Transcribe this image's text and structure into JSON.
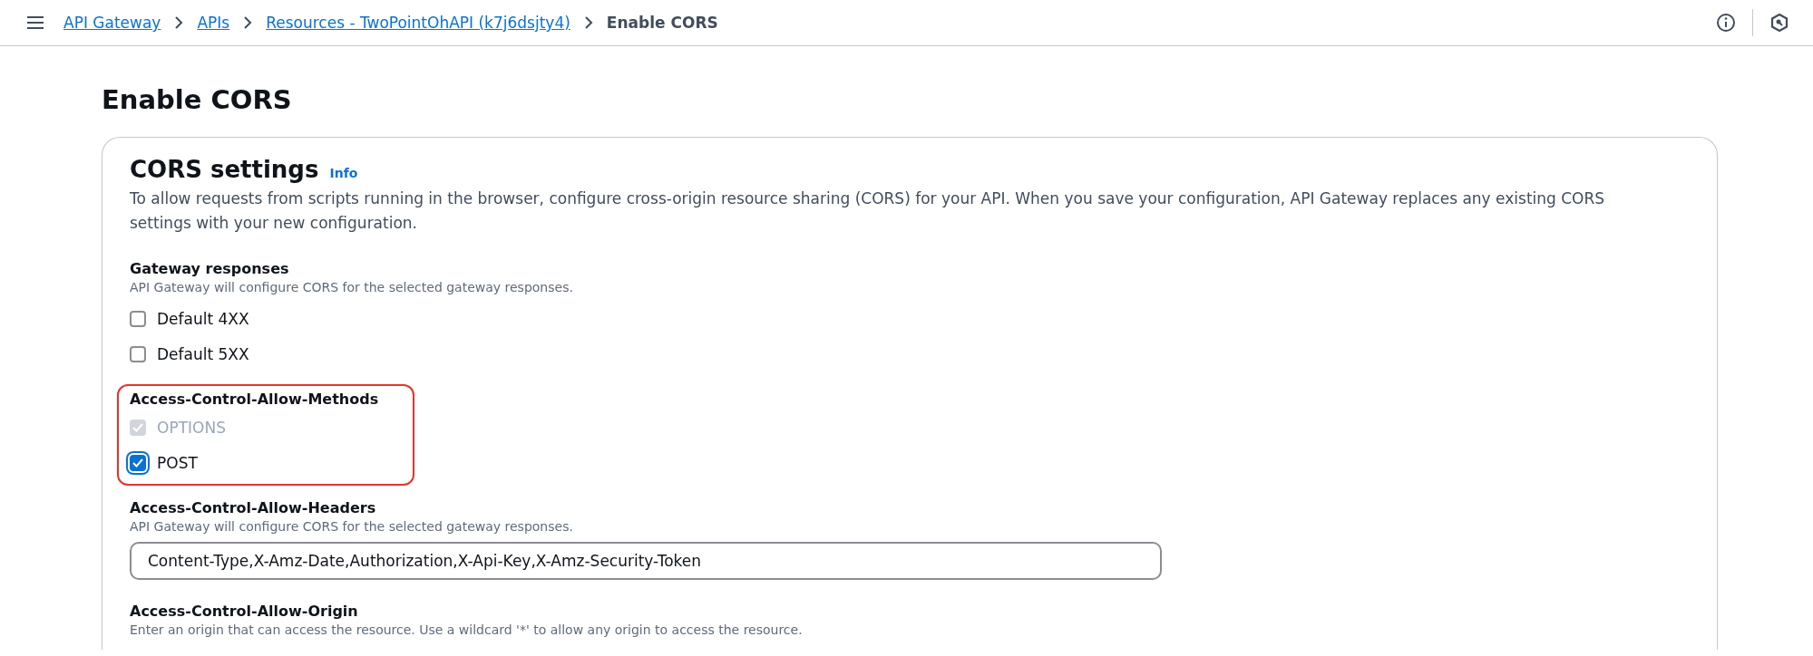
{
  "breadcrumbs": [
    {
      "label": "API Gateway",
      "kind": "link"
    },
    {
      "label": "APIs",
      "kind": "link"
    },
    {
      "label": "Resources - TwoPointOhAPI (k7j6dsjty4)",
      "kind": "link"
    },
    {
      "label": "Enable CORS",
      "kind": "current"
    }
  ],
  "page_title": "Enable CORS",
  "panel": {
    "title": "CORS settings",
    "info_link": "Info",
    "description": "To allow requests from scripts running in the browser, configure cross-origin resource sharing (CORS) for your API. When you save your configuration, API Gateway replaces any existing CORS settings with your new configuration.",
    "sections": [
      {
        "kind": "checkboxes",
        "label": "Gateway responses",
        "description": "API Gateway will configure CORS for the selected gateway responses.",
        "highlighted": false,
        "options": [
          {
            "label": "Default 4XX",
            "checked": false,
            "disabled": false
          },
          {
            "label": "Default 5XX",
            "checked": false,
            "disabled": false
          }
        ]
      },
      {
        "kind": "checkboxes",
        "label": "Access-Control-Allow-Methods",
        "highlighted": true,
        "options": [
          {
            "label": "OPTIONS",
            "checked": true,
            "disabled": true
          },
          {
            "label": "POST",
            "checked": true,
            "disabled": false
          }
        ]
      },
      {
        "kind": "input",
        "label": "Access-Control-Allow-Headers",
        "description": "API Gateway will configure CORS for the selected gateway responses.",
        "value": "Content-Type,X-Amz-Date,Authorization,X-Api-Key,X-Amz-Security-Token"
      },
      {
        "kind": "input",
        "label": "Access-Control-Allow-Origin",
        "description": "Enter an origin that can access the resource. Use a wildcard '*' to allow any origin to access the resource."
      }
    ]
  }
}
